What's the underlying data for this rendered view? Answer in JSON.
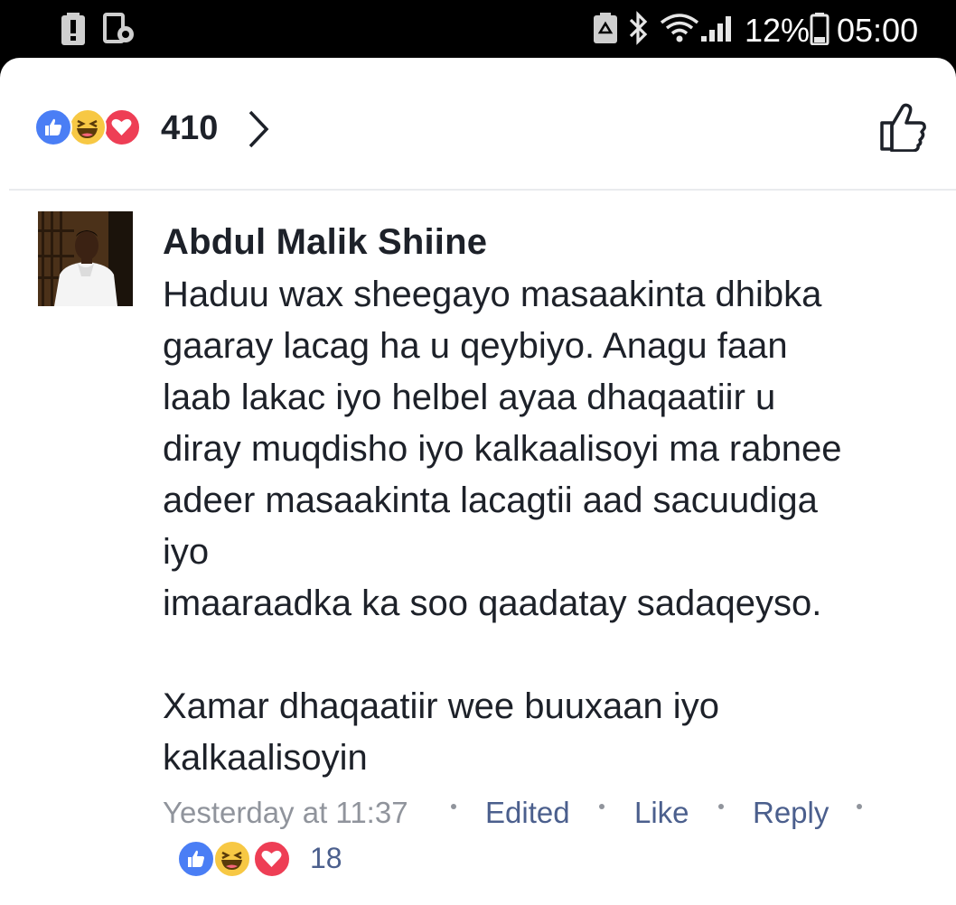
{
  "status_bar": {
    "battery_percent": "12%",
    "time": "05:00",
    "icons": [
      "battery-alert-icon",
      "screenshot-icon",
      "recycle-icon",
      "bluetooth-icon",
      "wifi-icon",
      "signal-icon",
      "battery-icon"
    ]
  },
  "reactions_header": {
    "types": [
      "like-icon",
      "haha-icon",
      "love-icon"
    ],
    "count": "410",
    "chevron": "chevron-right-icon",
    "like_button_icon": "thumbs-up-outline-icon"
  },
  "comment": {
    "author": "Abdul Malik Shiine",
    "lines": [
      "Haduu wax sheegayo masaakinta dhibka",
      "gaaray lacag ha u qeybiyo. Anagu faan",
      "laab lakac iyo helbel ayaa dhaqaatiir u",
      "diray muqdisho iyo kalkaalisoyi ma rabnee",
      "adeer masaakinta lacagtii aad sacuudiga",
      "iyo",
      "imaaraadka ka soo qaadatay sadaqeyso.",
      "",
      "Xamar dhaqaatiir wee buuxaan iyo",
      "kalkaalisoyin"
    ],
    "timestamp": "Yesterday at 11:37",
    "edited_label": "Edited",
    "like_label": "Like",
    "reply_label": "Reply",
    "reaction_count": "18"
  },
  "colors": {
    "like_blue": "#4a7ef5",
    "love_red": "#ee3e55",
    "haha_yellow": "#f7c844",
    "link_blue": "#4b5f8d",
    "meta_gray": "#90949c",
    "text_dark": "#1d2129"
  }
}
